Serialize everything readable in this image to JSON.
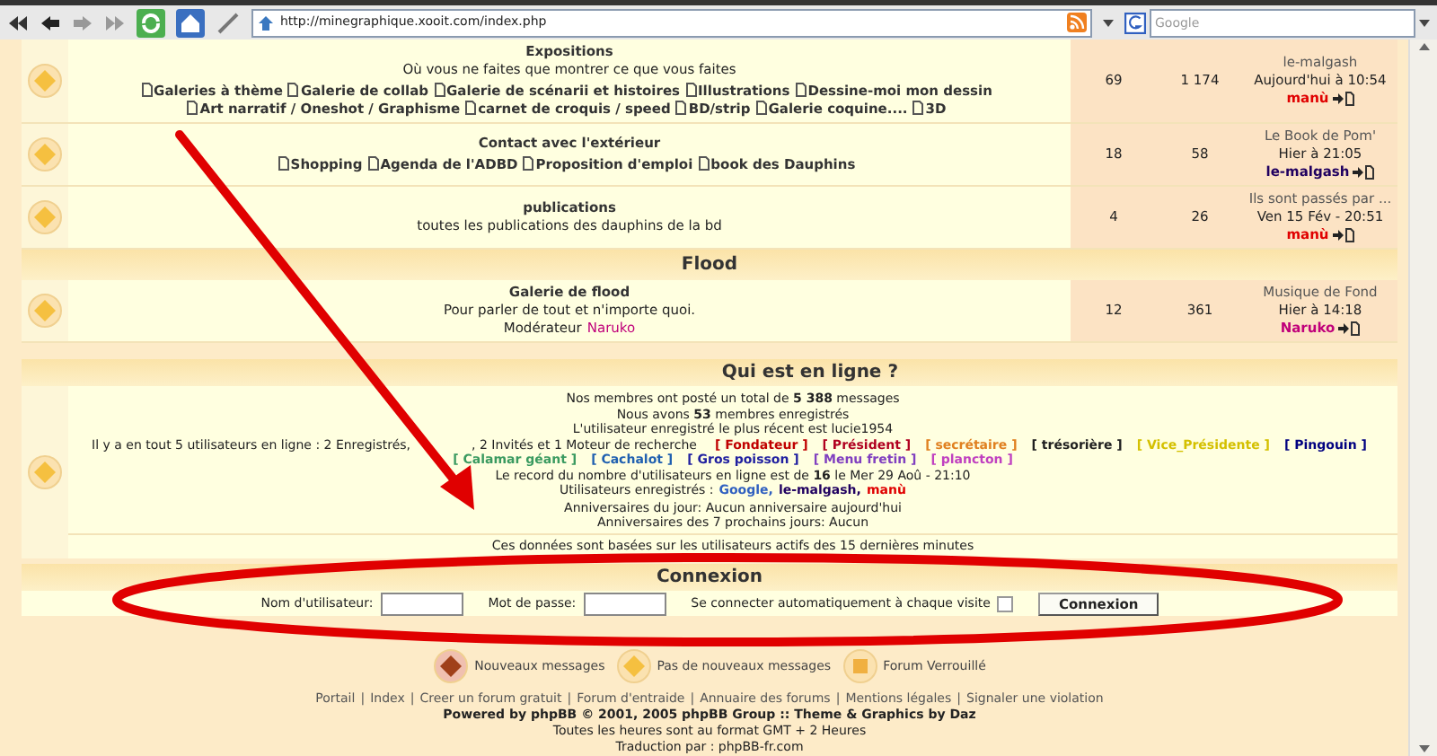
{
  "browser": {
    "url": "http://minegraphique.xooit.com/index.php",
    "search_placeholder": "Google"
  },
  "forums": [
    {
      "kind": "forum",
      "title": "Expositions",
      "description": "Où vous ne faites que montrer ce que vous faites",
      "subforums": [
        "Galeries à thème",
        "Galerie de collab",
        "Galerie de scénarii et histoires",
        "Illustrations",
        "Dessine-moi mon dessin",
        "Art narratif / Oneshot / Graphisme",
        "carnet de croquis / speed",
        "BD/strip",
        "Galerie coquine....",
        "3D"
      ],
      "topics": "69",
      "posts": "1 174",
      "last_post": {
        "title": "le-malgash",
        "date": "Aujourd'hui à 10:54",
        "author": "manù",
        "color": "#e00000"
      }
    },
    {
      "kind": "forum",
      "title": "Contact avec l'extérieur",
      "subforums": [
        "Shopping",
        "Agenda de l'ADBD",
        "Proposition d'emploi",
        "book des Dauphins"
      ],
      "topics": "18",
      "posts": "58",
      "last_post": {
        "title": "Le Book de Pom'",
        "date": "Hier à 21:05",
        "author": "le-malgash",
        "color": "#200060"
      }
    },
    {
      "kind": "forum",
      "title": "publications",
      "description": "toutes les publications des dauphins de la bd",
      "topics": "4",
      "posts": "26",
      "last_post": {
        "title": "Ils sont passés par ...",
        "date": "Ven 15 Fév - 20:51",
        "author": "manù",
        "color": "#e00000"
      }
    },
    {
      "kind": "category",
      "title": "Flood"
    },
    {
      "kind": "forum",
      "title": "Galerie de flood",
      "description": "Pour parler de tout et n'importe quoi.",
      "moderator_label": "Modérateur",
      "moderator": {
        "name": "Naruko",
        "color": "#c0007a"
      },
      "topics": "12",
      "posts": "361",
      "last_post": {
        "title": "Musique de Fond",
        "date": "Hier à 14:18",
        "author": "Naruko",
        "color": "#c0007a"
      }
    }
  ],
  "online": {
    "title": "Qui est en ligne ?",
    "stats": [
      "Nos membres ont posté un total de **5 388** messages",
      "Nous avons **53** membres enregistrés",
      "L'utilisateur enregistré le plus récent est lucie1954"
    ],
    "users_line_start": "Il y a en tout 5 utilisateurs en ligne : 2 Enregistrés,",
    "users_line_end": ", 2 Invités et 1 Moteur de recherche",
    "groups": [
      {
        "name": "[ Fondateur ]",
        "color": "#c00000"
      },
      {
        "name": "[ Président ]",
        "color": "#b00020"
      },
      {
        "name": "[ secrétaire ]",
        "color": "#e08020"
      },
      {
        "name": "[ trésorière ]",
        "color": "#202020"
      },
      {
        "name": "[ Vice_Présidente ]",
        "color": "#d4c000"
      },
      {
        "name": "[ Pingouin ]",
        "color": "#000080"
      },
      {
        "name": "[ Calamar géant ]",
        "color": "#3a9a60"
      },
      {
        "name": "[ Cachalot ]",
        "color": "#2060b0"
      },
      {
        "name": "[ Gros poisson ]",
        "color": "#2020a0"
      },
      {
        "name": "[ Menu fretin ]",
        "color": "#8040c0"
      },
      {
        "name": "[ plancton ]",
        "color": "#c040c0"
      }
    ],
    "record": "Le record du nombre d'utilisateurs en ligne est de **16** le Mer 29 Aoû - 21:10",
    "registered_label": "Utilisateurs enregistrés :",
    "registered": [
      {
        "name": "Google,",
        "color": "#3060c0"
      },
      {
        "name": "le-malgash,",
        "color": "#200060"
      },
      {
        "name": "manù",
        "color": "#e00000"
      }
    ],
    "birthdays": [
      "Anniversaires du jour: Aucun anniversaire aujourd'hui",
      "Anniversaires des 7 prochains jours: Aucun"
    ],
    "note": "Ces données sont basées sur les utilisateurs actifs des 15 dernières minutes"
  },
  "login": {
    "title": "Connexion",
    "username_label": "Nom d'utilisateur:",
    "password_label": "Mot de passe:",
    "autologin_label": "Se connecter automatiquement à chaque visite",
    "autologin_checked": false,
    "button": "Connexion"
  },
  "legend": [
    {
      "kind": "new",
      "label": "Nouveaux messages"
    },
    {
      "kind": "none",
      "label": "Pas de nouveaux messages"
    },
    {
      "kind": "locked",
      "label": "Forum Verrouillé"
    }
  ],
  "footer": {
    "separator": "|",
    "links": [
      "Portail",
      "Index",
      "Creer un forum gratuit",
      "Forum d'entraide",
      "Annuaire des forums",
      "Mentions légales",
      "Signaler une violation"
    ],
    "lines": [
      "Powered by phpBB © 2001, 2005 phpBB Group :: Theme & Graphics by Daz",
      "Toutes les heures sont au format GMT + 2 Heures",
      "Traduction par : phpBB-fr.com"
    ]
  }
}
